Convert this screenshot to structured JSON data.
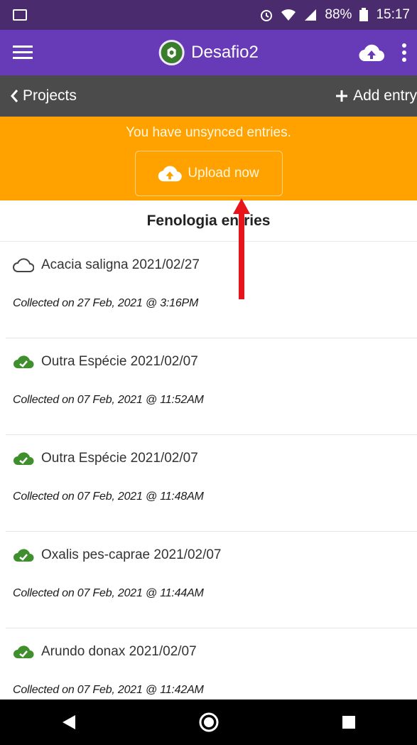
{
  "status_bar": {
    "battery": "88%",
    "time": "15:17"
  },
  "app_bar": {
    "title": "Desafio2"
  },
  "nav": {
    "back_label": "Projects",
    "add_label": "Add entry"
  },
  "banner": {
    "message": "You have unsynced entries.",
    "upload_label": "Upload now"
  },
  "section": {
    "title": "Fenologia entries"
  },
  "entries": [
    {
      "title": "Acacia saligna 2021/02/27",
      "collected": "Collected on 27 Feb, 2021 @ 3:16PM",
      "synced": false
    },
    {
      "title": "Outra Espécie 2021/02/07",
      "collected": "Collected on 07 Feb, 2021 @ 11:52AM",
      "synced": true
    },
    {
      "title": "Outra Espécie 2021/02/07",
      "collected": "Collected on 07 Feb, 2021 @ 11:48AM",
      "synced": true
    },
    {
      "title": "Oxalis pes-caprae 2021/02/07",
      "collected": "Collected on 07 Feb, 2021 @ 11:44AM",
      "synced": true
    },
    {
      "title": "Arundo donax 2021/02/07",
      "collected": "Collected on 07 Feb, 2021 @ 11:42AM",
      "synced": true
    }
  ],
  "colors": {
    "status_bar": "#4a2b6e",
    "app_bar": "#673ab7",
    "nav_bar": "#4b4b4b",
    "banner": "#ffa200",
    "synced_icon": "#3f8f2e",
    "annotation_arrow": "#e8141b"
  }
}
